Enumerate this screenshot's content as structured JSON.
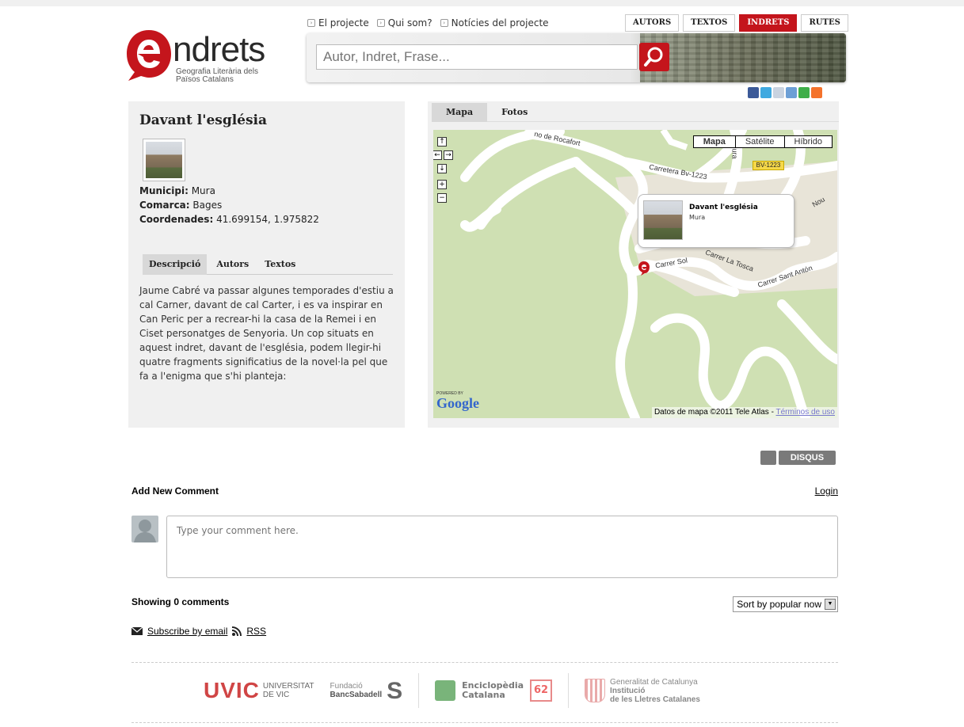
{
  "brand": {
    "name": "ndrets",
    "subtitle_line1": "Geografia Literària dels",
    "subtitle_line2": "Països Catalans",
    "accent_color": "#c4151c"
  },
  "top_links": [
    {
      "label": "El projecte"
    },
    {
      "label": "Qui som?"
    },
    {
      "label": "Notícies del projecte"
    }
  ],
  "nav_tabs": [
    {
      "label": "AUTORS",
      "active": false
    },
    {
      "label": "TEXTOS",
      "active": false
    },
    {
      "label": "INDRETS",
      "active": true
    },
    {
      "label": "RUTES",
      "active": false
    }
  ],
  "search": {
    "placeholder": "Autor, Indret, Frase..."
  },
  "share_icons": [
    "facebook-icon",
    "twitter-icon",
    "email-icon",
    "delicious-icon",
    "stumbleupon-icon",
    "addthis-icon"
  ],
  "place": {
    "title": "Davant l'església",
    "municipi_label": "Municipi:",
    "municipi": "Mura",
    "comarca_label": "Comarca:",
    "comarca": "Bages",
    "coords_label": "Coordenades:",
    "coords": "41.699154, 1.975822"
  },
  "subtabs": [
    {
      "label": "Descripció",
      "active": true
    },
    {
      "label": "Autors",
      "active": false
    },
    {
      "label": "Textos",
      "active": false
    }
  ],
  "description": "Jaume Cabré va passar algunes temporades d'estiu a cal Carner, davant de cal Carter, i es va inspirar en Can Peric per a recrear-hi la casa de la Remei i en Ciset personatges de Senyoria. Un cop situats en aquest indret, davant de l'església, podem llegir-hi quatre fragments significatius de la novel·la pel que fa a l'enigma que s'hi planteja:",
  "map_tabs": [
    {
      "label": "Mapa",
      "active": true
    },
    {
      "label": "Fotos",
      "active": false
    }
  ],
  "map": {
    "types": [
      {
        "label": "Mapa",
        "active": true
      },
      {
        "label": "Satélite",
        "active": false
      },
      {
        "label": "Híbrido",
        "active": false
      }
    ],
    "controls": [
      "↑",
      "←",
      "→",
      "↓",
      "+",
      "−"
    ],
    "info_title": "Davant l'església",
    "info_sub": "Mura",
    "labels": {
      "rocafort": "no de Rocafort",
      "carretera": "Carretera Bv-1223",
      "bv": "BV-1223",
      "sol": "Carrer Sol",
      "tosca": "Carrer La Tosca",
      "anton": "Carrer Sant Antón",
      "nou": "Nou",
      "ura": "ura"
    },
    "powered": "POWERED BY",
    "google": "Google",
    "attribution": "Datos de mapa ©2011 Tele Atlas - ",
    "terms": "Términos de uso",
    "land_color": "#cfe0b3",
    "road_color": "#ffffff"
  },
  "comments": {
    "disqus": "DISQUS",
    "add_new": "Add New Comment",
    "login": "Login",
    "placeholder": "Type your comment here.",
    "showing": "Showing 0 comments",
    "sort": "Sort by popular now",
    "subscribe": "Subscribe by email",
    "rss": "RSS"
  },
  "footer": {
    "uvic": "UVIC",
    "uvic_l1": "UNIVERSITAT",
    "uvic_l2": "DE VIC",
    "fund_l1": "Fundació",
    "fund_l2": "BancSabadell",
    "enc_l1": "Enciclopèdia",
    "enc_l2": "Catalana",
    "grup": "62",
    "gen_l1": "Generalitat de Catalunya",
    "gen_l2": "Institució",
    "gen_l3": "de les Lletres Catalanes"
  }
}
